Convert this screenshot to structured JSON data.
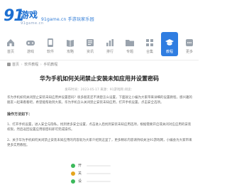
{
  "site": {
    "logo_number": "91",
    "logo_text": "游戏",
    "logo_sub": "91game.cn",
    "slogan": "91game.cn  手游玩家乐园"
  },
  "nav": {
    "items": [
      {
        "label": "首页",
        "icon": "home-icon"
      },
      {
        "label": "游戏",
        "icon": "gamepad-icon"
      },
      {
        "label": "软件",
        "icon": "app-icon"
      },
      {
        "label": "攻略",
        "icon": "book-icon"
      },
      {
        "label": "资讯",
        "icon": "news-icon"
      },
      {
        "label": "排行",
        "icon": "chart-icon"
      },
      {
        "label": "专题",
        "icon": "folder-icon"
      },
      {
        "label": "合集",
        "icon": "grid-icon"
      },
      {
        "label": "教程",
        "icon": "grad-icon",
        "active": true
      },
      {
        "label": "更多",
        "icon": "more-icon"
      }
    ],
    "accent": "#2f7de1"
  },
  "breadcrumb": {
    "home": "首页",
    "level1": "软件教程",
    "level2": "手机教程"
  },
  "article": {
    "title": "华为手机如何关闭禁止安装未知应用并设置密码",
    "meta": "发布时间：2023-05-17  来源：91游戏网  阅读：",
    "para1": "华为手机如何关闭禁止安装未知应用并设置密码？很多朋友还不清楚怎么设置，下面就让小编为大家带来详细的设置教程，感兴趣的朋友一起来看看吧，希望能帮助到大家。华为手机怎么关闭禁止安装未知应用，打开手机设置，点击安全选项。",
    "section": "操作方法如下：",
    "para2": "1、打开手机设置，进入安全与隐私，找到更多安全设置，点击进入后找到安装未知应用选项，根据需要开启或关闭对应应用的安装权限，然后返回设置应用锁密码即可完成操作。",
    "para3": "2、关于华为手机如何关闭禁止安装未知应用的内容就为大家介绍到这里了，更多精彩内容请持续关注91游戏网，小编会为大家带来更多实用教程。"
  },
  "options": [
    {
      "label": "开",
      "color": "#3cb95b"
    },
    {
      "label": "关",
      "color": "#e5a51d"
    },
    {
      "label": "设",
      "color": "#3cb95b"
    }
  ]
}
